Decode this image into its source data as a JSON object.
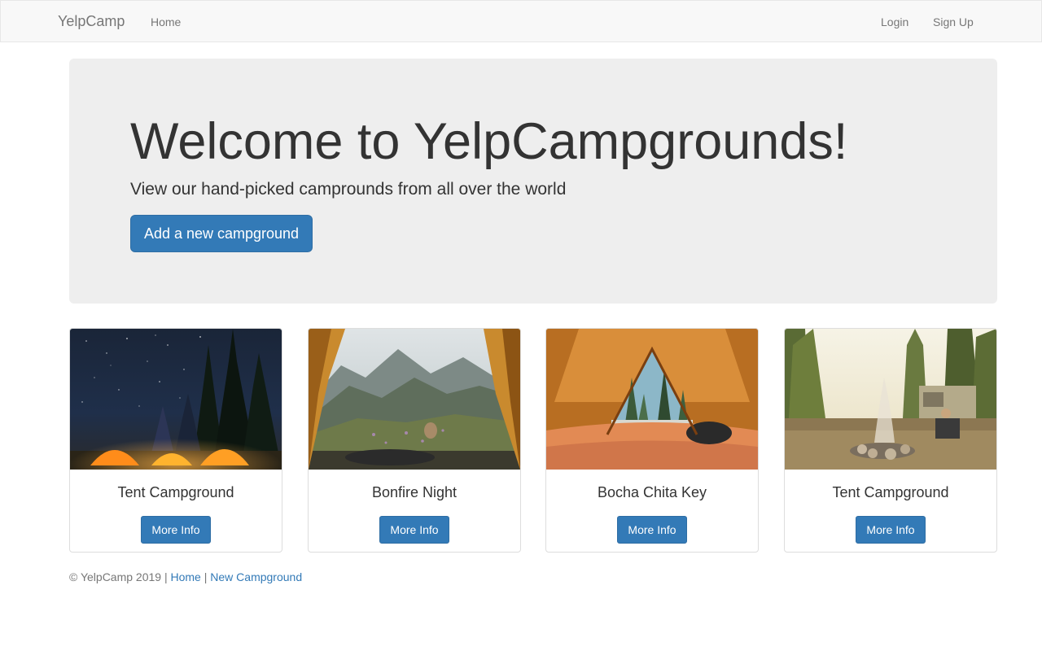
{
  "nav": {
    "brand": "YelpCamp",
    "home": "Home",
    "login": "Login",
    "signup": "Sign Up"
  },
  "jumbotron": {
    "title": "Welcome to YelpCampgrounds!",
    "subtitle": "View our hand-picked camprounds from all over the world",
    "button": "Add a new campground"
  },
  "cards": [
    {
      "title": "Tent Campground",
      "button": "More Info",
      "image": "starry-night-tents-photo"
    },
    {
      "title": "Bonfire Night",
      "button": "More Info",
      "image": "tent-view-mountains-photo"
    },
    {
      "title": "Bocha Chita Key",
      "button": "More Info",
      "image": "tent-view-forest-photo"
    },
    {
      "title": "Tent Campground",
      "button": "More Info",
      "image": "campfire-tent-trailer-photo"
    }
  ],
  "footer": {
    "copyright": "© YelpCamp 2019",
    "sep1": " | ",
    "home": "Home",
    "sep2": " | ",
    "new_campground": "New Campground"
  },
  "colors": {
    "primary": "#337ab7",
    "jumbotron_bg": "#eeeeee",
    "navbar_bg": "#f8f8f8"
  }
}
